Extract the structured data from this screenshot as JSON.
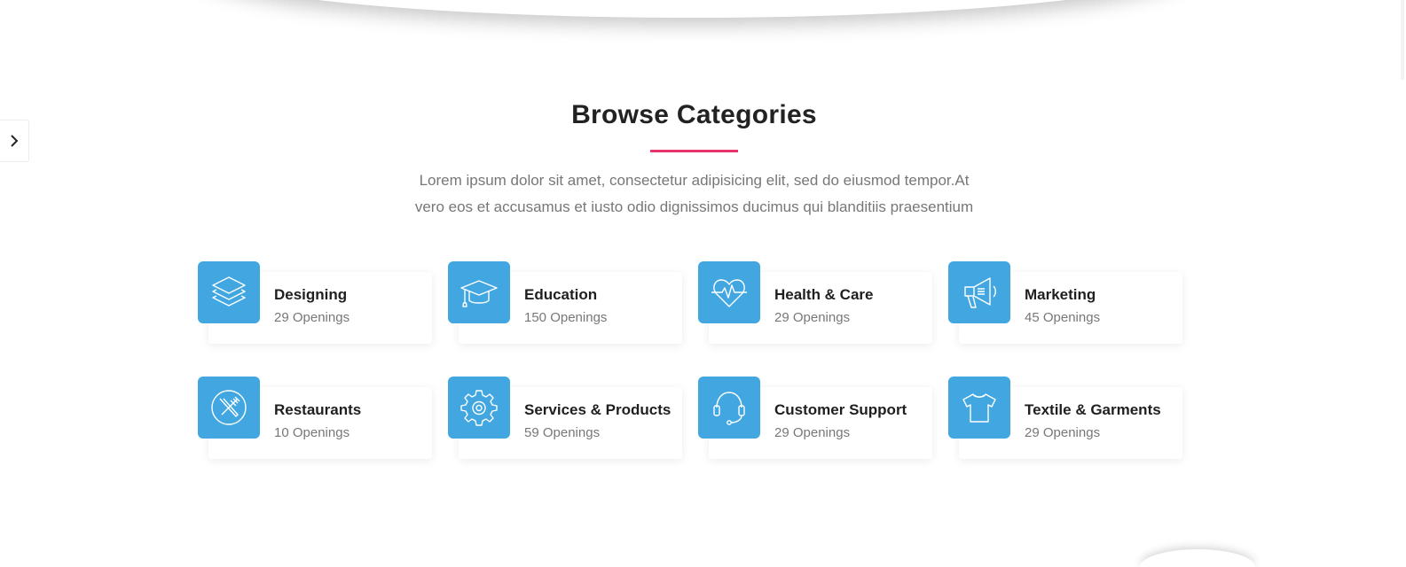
{
  "section": {
    "title": "Browse Categories",
    "description_line1": "Lorem ipsum dolor sit amet, consectetur adipisicing elit, sed do eiusmod tempor.At",
    "description_line2": "vero eos et accusamus et iusto odio dignissimos ducimus qui blanditiis praesentium"
  },
  "colors": {
    "accent": "#e8336b",
    "icon_bg": "#42a7e0"
  },
  "side_toggle": {
    "icon": "chevron-right-icon"
  },
  "categories": [
    {
      "title": "Designing",
      "openings": "29 Openings",
      "icon": "layers-icon"
    },
    {
      "title": "Education",
      "openings": "150 Openings",
      "icon": "graduation-cap-icon"
    },
    {
      "title": "Health & Care",
      "openings": "29 Openings",
      "icon": "heart-pulse-icon"
    },
    {
      "title": "Marketing",
      "openings": "45 Openings",
      "icon": "megaphone-icon"
    },
    {
      "title": "Restaurants",
      "openings": "10 Openings",
      "icon": "fork-knife-icon"
    },
    {
      "title": "Services & Products",
      "openings": "59 Openings",
      "icon": "gear-icon"
    },
    {
      "title": "Customer Support",
      "openings": "29 Openings",
      "icon": "headset-icon"
    },
    {
      "title": "Textile & Garments",
      "openings": "29 Openings",
      "icon": "tshirt-icon"
    }
  ]
}
